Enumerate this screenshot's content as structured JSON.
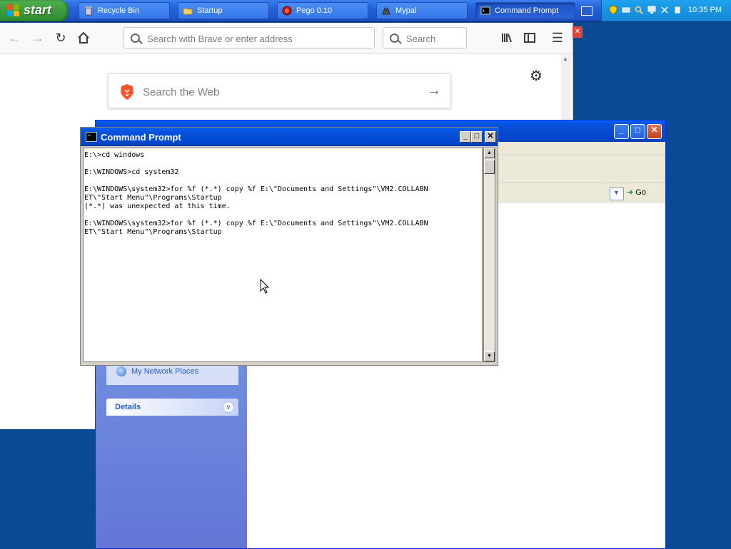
{
  "taskbar": {
    "start_label": "start",
    "buttons": [
      {
        "label": "Recycle Bin",
        "icon": "recycle-bin-icon"
      },
      {
        "label": "Startup",
        "icon": "folder-icon"
      },
      {
        "label": "Pego 0.10",
        "icon": "pego-icon"
      },
      {
        "label": "Mypal",
        "icon": "mypal-icon"
      },
      {
        "label": "Command Prompt",
        "icon": "command-prompt-icon"
      }
    ],
    "active_button": "Command Prompt",
    "clock": "10:35 PM"
  },
  "browser": {
    "url_placeholder": "Search with Brave or enter address",
    "search_placeholder": "Search",
    "page_search_placeholder": "Search the Web"
  },
  "explorer": {
    "go_label": "Go",
    "network_places_label": "My Network Places",
    "details_label": "Details"
  },
  "cmd": {
    "title": "Command Prompt",
    "output": "E:\\>cd windows\n\nE:\\WINDOWS>cd system32\n\nE:\\WINDOWS\\system32>for %f (*.*) copy %f E:\\\"Documents and Settings\"\\VM2.COLLABN\nET\\\"Start Menu\"\\Programs\\Startup\n(*.*) was unexpected at this time.\n\nE:\\WINDOWS\\system32>for %f (*.*) copy %f E:\\\"Documents and Settings\"\\VM2.COLLABN\nET\\\"Start Menu\"\\Programs\\Startup"
  }
}
